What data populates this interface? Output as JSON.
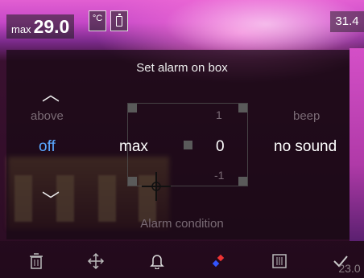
{
  "status": {
    "max_label": "max",
    "max_value": "29.0",
    "unit": "°C",
    "scale_top": "31.4",
    "scale_bottom": "23.0"
  },
  "dialog": {
    "title": "Set alarm on box",
    "footer": "Alarm condition",
    "columns": {
      "condition": {
        "header": "above",
        "value": "off"
      },
      "measure": {
        "value": "max"
      },
      "threshold": {
        "prev": "1",
        "value": "0",
        "next": "-1"
      },
      "sound": {
        "header": "beep",
        "value": "no sound"
      }
    }
  },
  "toolbar": {
    "items": [
      "trash-icon",
      "move-icon",
      "bell-icon",
      "color-icon",
      "grid-icon",
      "check-icon"
    ]
  },
  "colors": {
    "selected": "#5aa8ff",
    "dim": "#7a6b75"
  }
}
